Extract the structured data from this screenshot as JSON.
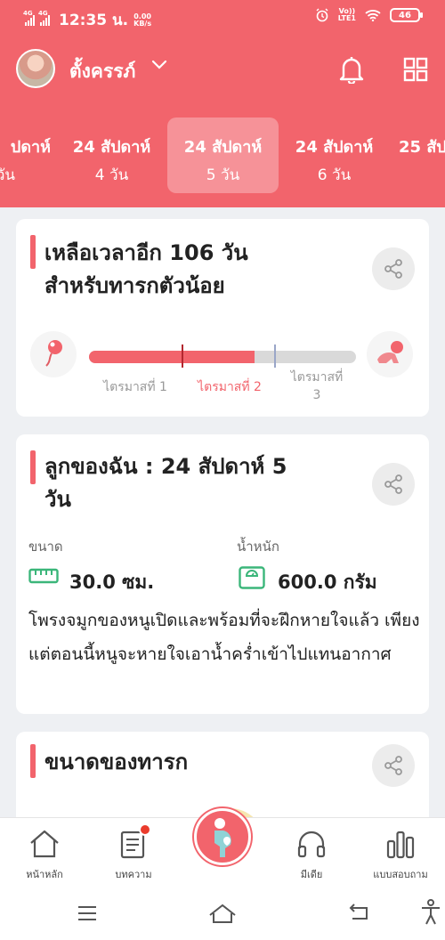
{
  "status": {
    "time": "12:35 น.",
    "speed": "0.00\nKB/s",
    "net1": "4G",
    "net2": "4G",
    "lte": "Vo))\nLTE1",
    "battery": "46"
  },
  "user": {
    "name": "ตั้งครรภ์"
  },
  "weeks": [
    {
      "w": "ปดาห์",
      "d": "วัน"
    },
    {
      "w": "24 สัปดาห์",
      "d": "4 วัน"
    },
    {
      "w": "24 สัปดาห์",
      "d": "5 วัน"
    },
    {
      "w": "24 สัปดาห์",
      "d": "6 วัน"
    },
    {
      "w": "25 สัป",
      "d": ""
    }
  ],
  "countdown": {
    "line1": "เหลือเวลาอีก 106 วัน",
    "line2": "สำหรับทารกตัวน้อย",
    "progress_percent": 62,
    "trimesters": [
      "ไตรมาสที่ 1",
      "ไตรมาสที่ 2",
      "ไตรมาสที่\n3"
    ],
    "active_trimester": 2
  },
  "baby": {
    "line1": "ลูกของฉัน : 24 สัปดาห์ 5",
    "line2": "วัน",
    "size_label": "ขนาด",
    "size_value": "30.0 ซม.",
    "weight_label": "น้ำหนัก",
    "weight_value": "600.0 กรัม",
    "description": "โพรงจมูกของหนูเปิดและพร้อมที่จะฝึกหายใจแล้ว เพียงแต่ตอนนี้หนูจะหายใจเอาน้ำคร่ำเข้าไปแทนอากาศ"
  },
  "size_card": {
    "title": "ขนาดของทารก"
  },
  "nav": {
    "home": "หน้าหลัก",
    "articles": "บทความ",
    "media": "มีเดีย",
    "quiz": "แบบสอบถาม"
  },
  "colors": {
    "brand": "#f2646c",
    "accent_green": "#3bb67a"
  }
}
